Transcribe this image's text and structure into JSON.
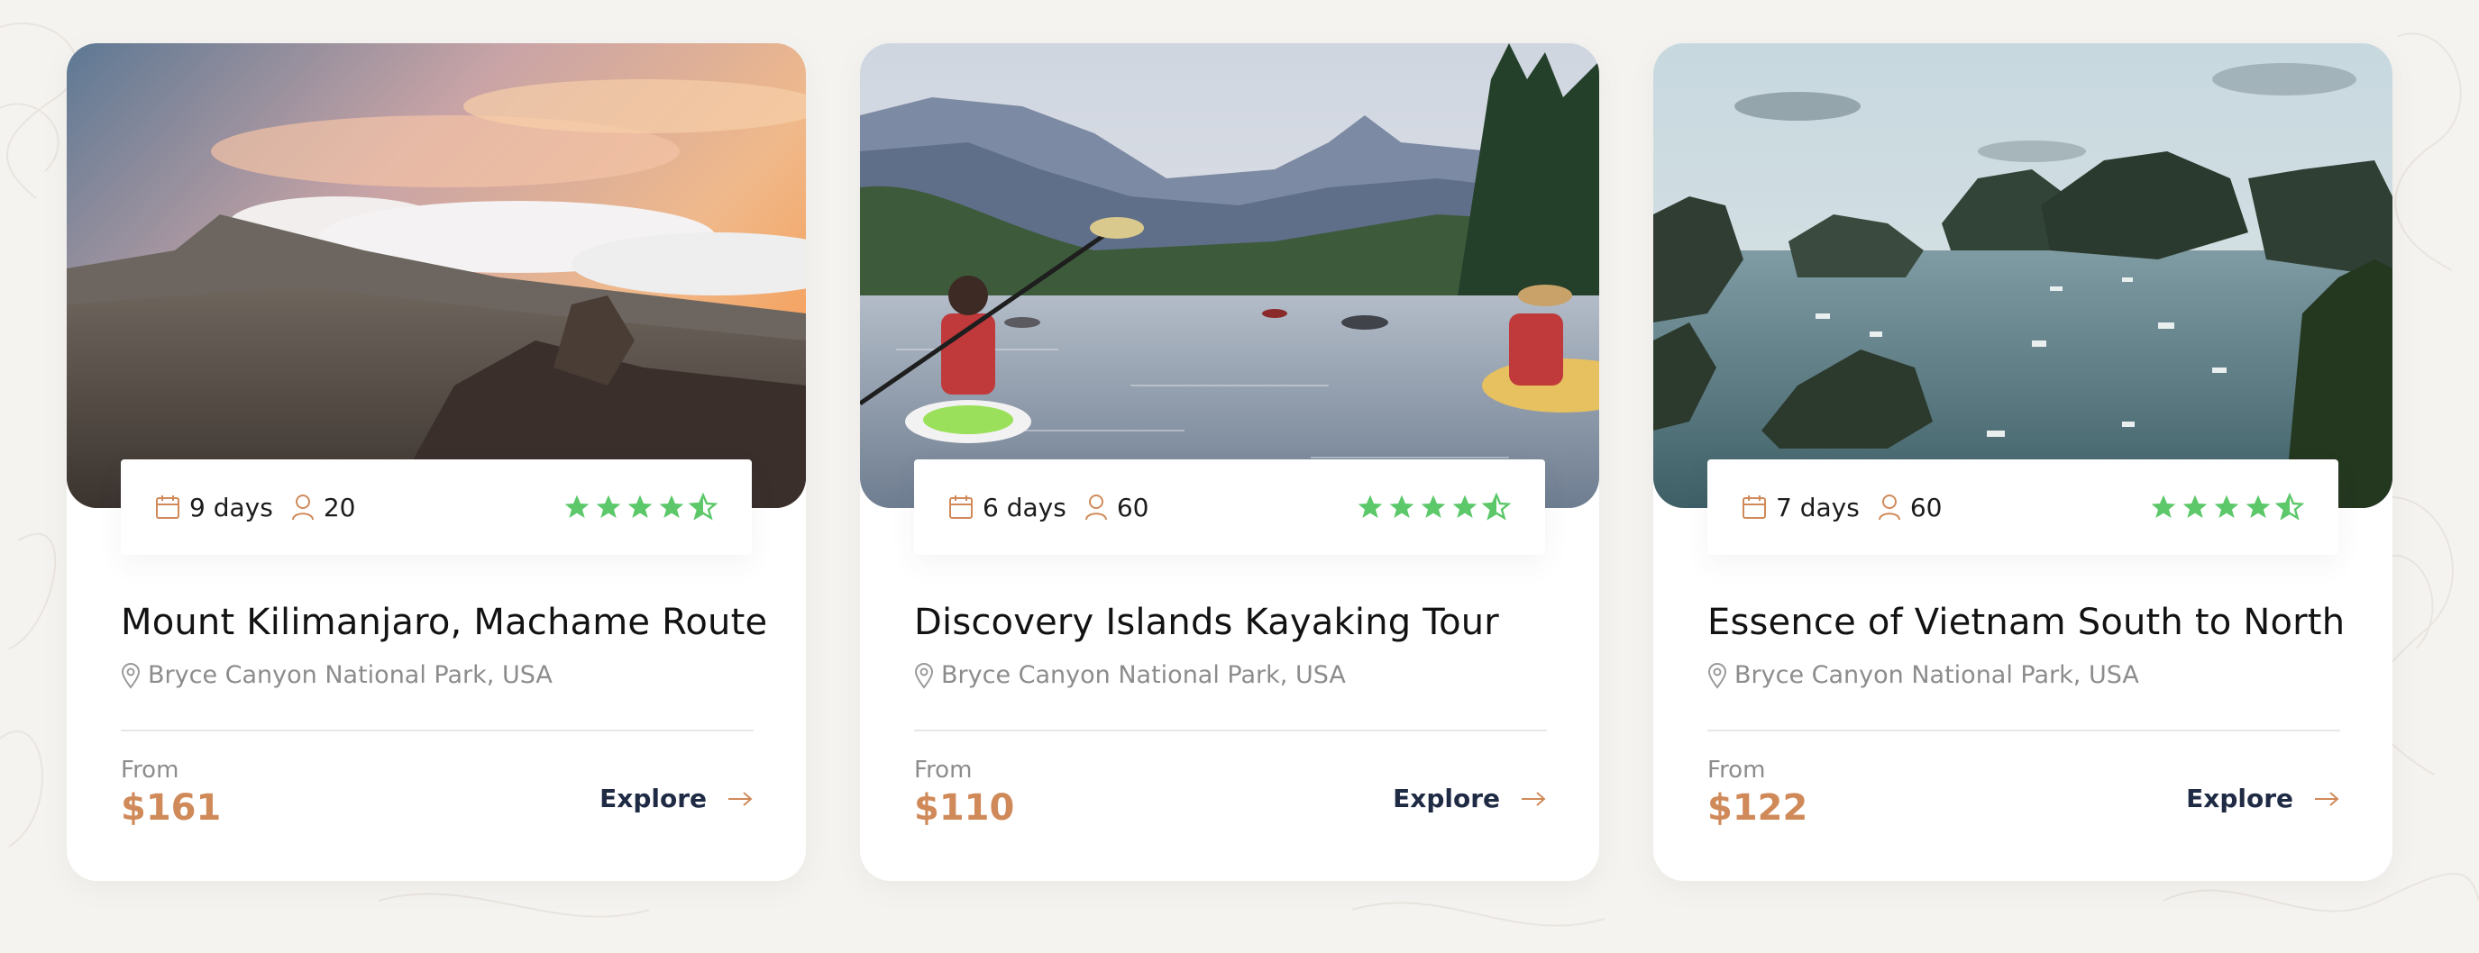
{
  "colors": {
    "accent": "#d08a5a",
    "star": "#5cc86a",
    "explore_text": "#1f2a44",
    "muted": "#8c8c8c"
  },
  "cards": [
    {
      "duration": "9 days",
      "group_size": "20",
      "rating": 4.5,
      "title": "Mount Kilimanjaro, Machame Route",
      "location": "Bryce Canyon National Park, USA",
      "from_label": "From",
      "price": "$161",
      "explore_label": "Explore",
      "image_icon": "mountain-sunset-photo"
    },
    {
      "duration": "6 days",
      "group_size": "60",
      "rating": 4.5,
      "title": "Discovery Islands Kayaking Tour",
      "location": "Bryce Canyon National Park, USA",
      "from_label": "From",
      "price": "$110",
      "explore_label": "Explore",
      "image_icon": "kayaking-lake-photo"
    },
    {
      "duration": "7 days",
      "group_size": "60",
      "rating": 4.5,
      "title": "Essence of Vietnam South to North",
      "location": "Bryce Canyon National Park, USA",
      "from_label": "From",
      "price": "$122",
      "explore_label": "Explore",
      "image_icon": "bay-islands-photo"
    }
  ]
}
